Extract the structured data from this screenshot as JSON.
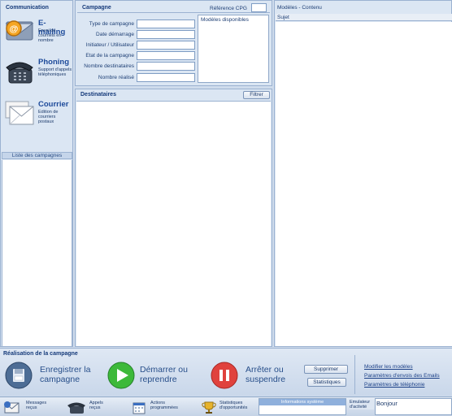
{
  "communication": {
    "title": "Communication",
    "items": [
      {
        "title": "E-mailing",
        "desc": "Envoi de courriels en nombre",
        "icon": "email-icon"
      },
      {
        "title": "Phoning",
        "desc": "Support d'appels téléphoniques",
        "icon": "phone-icon"
      },
      {
        "title": "Courrier",
        "desc": "Edition de courriers postaux",
        "icon": "mail-envelope-icon"
      }
    ],
    "campaign_list_title": "Liste des campagnes"
  },
  "campagne": {
    "title": "Campagne",
    "ref_label": "Référence CPG",
    "ref_value": "",
    "fields": [
      {
        "label": "Type de campagne",
        "value": ""
      },
      {
        "label": "Date démarrage",
        "value": ""
      },
      {
        "label": "Initiateur / Utilisateur",
        "value": ""
      },
      {
        "label": "Etat de la campagne",
        "value": ""
      },
      {
        "label": "Nombre destinataires",
        "value": ""
      },
      {
        "label": "Nombre réalisé",
        "value": ""
      }
    ],
    "models_label": "Modèles disponibles"
  },
  "destinataires": {
    "title": "Destinataires",
    "filter_button": "Filtrer"
  },
  "modeles": {
    "title": "Modèles - Contenu",
    "column_subject": "Sujet"
  },
  "realisation": {
    "title": "Réalisation de la campagne",
    "save_label": "Enregistrer la campagne",
    "start_label": "Démarrer ou reprendre",
    "stop_label": "Arrêter ou suspendre",
    "delete_button": "Supprimer",
    "stats_button": "Statistiques",
    "links": [
      "Modifier les modèles",
      "Paramètres d'envois des Emails",
      "Paramètres de téléphonie"
    ]
  },
  "taskbar": {
    "items": [
      {
        "label": "Messages reçus",
        "icon": "inbox-icon"
      },
      {
        "label": "Appels reçus",
        "icon": "phone-icon"
      },
      {
        "label": "Actions programmées",
        "icon": "calendar-icon"
      },
      {
        "label": "Statistiques d'opportunités",
        "icon": "trophy-icon"
      }
    ],
    "info_title": "Informations système",
    "activity_label": "Emulateur d'activité",
    "activity_value": "Bonjour"
  }
}
